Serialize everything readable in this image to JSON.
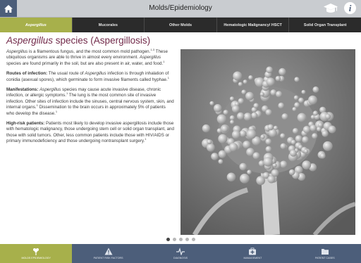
{
  "header": {
    "title": "Molds/Epidemiology"
  },
  "tabs": [
    {
      "label": "Aspergillus",
      "active": true
    },
    {
      "label": "Mucorales",
      "active": false
    },
    {
      "label": "Other Molds",
      "active": false
    },
    {
      "label": "Hematologic Malignancy/ HSCT",
      "active": false
    },
    {
      "label": "Solid Organ Transplant",
      "active": false
    }
  ],
  "article": {
    "title_italic": "Aspergillus",
    "title_rest": " species (Aspergillosis)",
    "intro": {
      "italic": "Aspergillus",
      "text1": " is a filamentous fungus, and the most common mold pathogen.",
      "ref1": "1-3",
      "text2": " These ubiquitous organisms are able to thrive in almost every environment. ",
      "italic2": "Aspergillus",
      "text3": " species are found primarily in the soil, but are also present in air, water, and food.",
      "ref2": "1"
    },
    "routes": {
      "label": "Routes of infection:",
      "text1": " The usual route of ",
      "italic": "Aspergillus",
      "text2": " infection is through inhalation of conidia (asexual spores), which germinate to form invasive filaments called hyphae.",
      "ref": "1"
    },
    "manifestations": {
      "label": "Manifestations:",
      "italic": "Aspergillus",
      "text1": " species may cause acute invasive disease, chronic infection, or allergic symptoms.",
      "ref1": "1",
      "text2": " The lung is the most common site of invasive infection. Other sites of infection include the sinuses, central nervous system, skin, and internal organs.",
      "ref2": "1",
      "text3": " Dissemination to the brain occurs in approximately 5% of patients who develop the disease.",
      "ref3": "1"
    },
    "risk": {
      "label": "High-risk patients:",
      "text": " Patients most likely to develop invasive aspergillosis include those with hematologic malignancy, those undergoing stem cell or solid organ transplant, and those with solid tumors. Other, less common patients include those with HIV/AIDS or primary immunodeficiency and those undergoing nontransplant surgery.",
      "ref": "1"
    }
  },
  "pager": {
    "count": 5,
    "active_index": 0
  },
  "bottom_nav": [
    {
      "label": "MOLDS EPIDEMIOLOGY",
      "icon": "mold-icon",
      "active": true
    },
    {
      "label": "PATIENT RISK FACTORS",
      "icon": "warning-icon",
      "active": false
    },
    {
      "label": "DIAGNOSIS",
      "icon": "pulse-icon",
      "active": false
    },
    {
      "label": "MANAGEMENT",
      "icon": "medical-kit-icon",
      "active": false
    },
    {
      "label": "PATIENT CASES",
      "icon": "folder-icon",
      "active": false
    }
  ],
  "colors": {
    "header_bg": "#c9ccd0",
    "nav_blue": "#4c5e7a",
    "accent_green": "#a7b04b",
    "tab_bar": "#2b2b2b",
    "title_maroon": "#722a4a"
  }
}
